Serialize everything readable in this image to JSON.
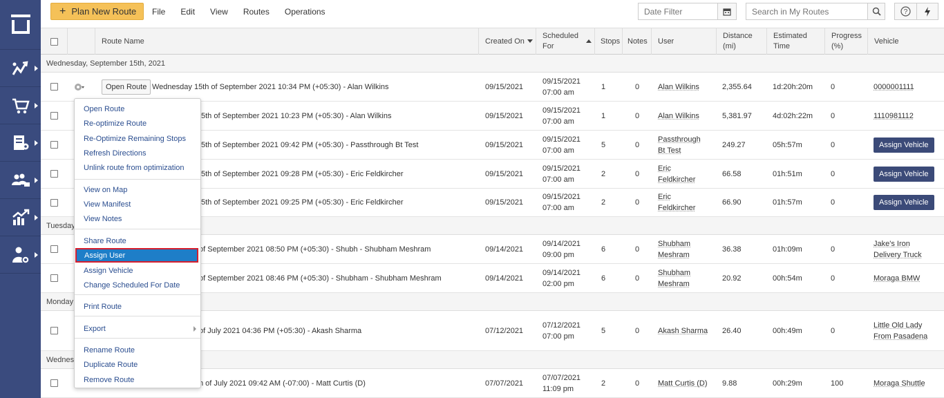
{
  "toolbar": {
    "plan_new_route": "Plan New Route",
    "menus": [
      "File",
      "Edit",
      "View",
      "Routes",
      "Operations"
    ],
    "date_filter_placeholder": "Date Filter",
    "search_placeholder": "Search in My Routes"
  },
  "columns": {
    "route_name": "Route Name",
    "created_on": "Created On",
    "scheduled_for": "Scheduled For",
    "stops": "Stops",
    "notes": "Notes",
    "user": "User",
    "distance": "Distance (mi)",
    "estimated_time": "Estimated Time",
    "progress": "Progress (%)",
    "vehicle": "Vehicle"
  },
  "groups": [
    "Wednesday, September 15th, 2021",
    "Tuesday",
    "Monday",
    "Wednes"
  ],
  "rows": [
    {
      "open_btn": "Open Route",
      "name": "Wednesday 15th of September 2021 10:34 PM (+05:30) - Alan Wilkins",
      "created": "09/15/2021",
      "sched_date": "09/15/2021",
      "sched_time": "07:00 am",
      "stops": "1",
      "notes": "0",
      "user1": "Alan Wilkins",
      "user2": "",
      "distance": "2,355.64",
      "time": "1d:20h:20m",
      "progress": "0",
      "vehicle1": "0000001111",
      "vehicle2": "",
      "assign": ""
    },
    {
      "name": "5th of September 2021 10:23 PM (+05:30) - Alan Wilkins",
      "created": "09/15/2021",
      "sched_date": "09/15/2021",
      "sched_time": "07:00 am",
      "stops": "1",
      "notes": "0",
      "user1": "Alan Wilkins",
      "user2": "",
      "distance": "5,381.97",
      "time": "4d:02h:22m",
      "progress": "0",
      "vehicle1": "1110981112",
      "vehicle2": "",
      "assign": ""
    },
    {
      "name": "5th of September 2021 09:42 PM (+05:30) - Passthrough Bt Test",
      "created": "09/15/2021",
      "sched_date": "09/15/2021",
      "sched_time": "07:00 am",
      "stops": "5",
      "notes": "0",
      "user1": "Passthrough",
      "user2": "Bt Test",
      "distance": "249.27",
      "time": "05h:57m",
      "progress": "0",
      "vehicle1": "",
      "vehicle2": "",
      "assign": "Assign Vehicle"
    },
    {
      "name": "5th of September 2021 09:28 PM (+05:30) - Eric Feldkircher",
      "created": "09/15/2021",
      "sched_date": "09/15/2021",
      "sched_time": "07:00 am",
      "stops": "2",
      "notes": "0",
      "user1": "Eric",
      "user2": "Feldkircher",
      "distance": "66.58",
      "time": "01h:51m",
      "progress": "0",
      "vehicle1": "",
      "vehicle2": "",
      "assign": "Assign Vehicle"
    },
    {
      "name": "5th of September 2021 09:25 PM (+05:30) - Eric Feldkircher",
      "created": "09/15/2021",
      "sched_date": "09/15/2021",
      "sched_time": "07:00 am",
      "stops": "2",
      "notes": "0",
      "user1": "Eric",
      "user2": "Feldkircher",
      "distance": "66.90",
      "time": "01h:57m",
      "progress": "0",
      "vehicle1": "",
      "vehicle2": "",
      "assign": "Assign Vehicle"
    },
    {
      "name": "of September 2021 08:50 PM (+05:30) - Shubh - Shubham Meshram",
      "created": "09/14/2021",
      "sched_date": "09/14/2021",
      "sched_time": "09:00 pm",
      "stops": "6",
      "notes": "0",
      "user1": "Shubham",
      "user2": "Meshram",
      "distance": "36.38",
      "time": "01h:09m",
      "progress": "0",
      "vehicle1": "Jake's Iron",
      "vehicle2": "Delivery Truck",
      "assign": ""
    },
    {
      "name": "of September 2021 08:46 PM (+05:30) - Shubham - Shubham Meshram",
      "created": "09/14/2021",
      "sched_date": "09/14/2021",
      "sched_time": "02:00 pm",
      "stops": "6",
      "notes": "0",
      "user1": "Shubham",
      "user2": "Meshram",
      "distance": "20.92",
      "time": "00h:54m",
      "progress": "0",
      "vehicle1": "Moraga BMW",
      "vehicle2": "",
      "assign": ""
    },
    {
      "name": "of July 2021 04:36 PM (+05:30) - Akash Sharma",
      "created": "07/12/2021",
      "sched_date": "07/12/2021",
      "sched_time": "07:00 pm",
      "stops": "5",
      "notes": "0",
      "user1": "Akash Sharma",
      "user2": "",
      "distance": "26.40",
      "time": "00h:49m",
      "progress": "0",
      "vehicle1": "Little Old Lady",
      "vehicle2": "From Pasadena",
      "assign": ""
    },
    {
      "name": "h of July 2021 09:42 AM (-07:00) - Matt Curtis (D)",
      "created": "07/07/2021",
      "sched_date": "07/07/2021",
      "sched_time": "11:09 pm",
      "stops": "2",
      "notes": "0",
      "user1": "Matt Curtis (D)",
      "user2": "",
      "distance": "9.88",
      "time": "00h:29m",
      "progress": "100",
      "vehicle1": "Moraga Shuttle",
      "vehicle2": "",
      "assign": ""
    }
  ],
  "context_menu": {
    "items": [
      "Open Route",
      "Re-optimize Route",
      "Re-Optimize Remaining Stops",
      "Refresh Directions",
      "Unlink route from optimization",
      "View on Map",
      "View Manifest",
      "View Notes",
      "Share Route",
      "Assign User",
      "Assign Vehicle",
      "Change Scheduled For Date",
      "Print Route",
      "Export",
      "Rename Route",
      "Duplicate Route",
      "Remove Route"
    ],
    "active": "Assign User"
  },
  "colors": {
    "sidebar": "#3a4b7e",
    "plan_button": "#f5c158",
    "assign_vehicle": "#3b4a78",
    "menu_link": "#2a4d8f",
    "menu_highlight": "#1e7ec8",
    "highlight_border": "#d61e2d"
  }
}
